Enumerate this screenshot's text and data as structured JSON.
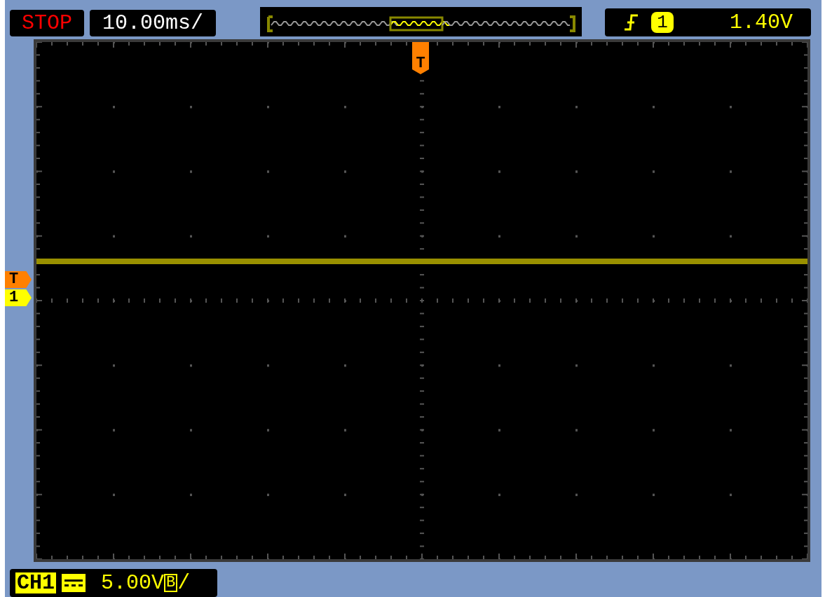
{
  "run_state": {
    "label": "STOP"
  },
  "timebase": "10.00ms/",
  "trigger": {
    "channel": "1",
    "level": "1.40V"
  },
  "markers": [
    {
      "kind": "trigger",
      "label": "T",
      "color": "#ff8000"
    },
    {
      "kind": "channel",
      "label": "1",
      "color": "#ffff00"
    }
  ],
  "top_marker": "T",
  "channel": {
    "name": "CH1",
    "scale": "5.00V",
    "bandwidth": "B",
    "suffix": "/"
  }
}
